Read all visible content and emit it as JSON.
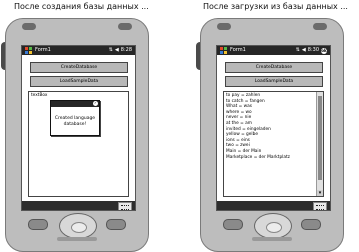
{
  "left": {
    "caption": "После создания базы данных ...",
    "window_title": "Form1",
    "time": "8:28",
    "buttons": [
      "CreateDatabase",
      "LoadSampleData"
    ],
    "textbox_text": "textBox",
    "popup_message": "Created language database!"
  },
  "right": {
    "caption": "После загрузки из  базы данных ...",
    "window_title": "Form1",
    "time": "8:30",
    "ok_label": "ok",
    "buttons": [
      "CreateDatabase",
      "LoadSampleData"
    ],
    "lines": [
      "to pay = zahlen",
      "to catch = fangen",
      "What = was",
      "where = wo",
      "never = nie",
      "at the = am",
      "invited = eingeladen",
      "yellow = gelbe",
      "ions = eins",
      "two = zwei",
      "Main = der Main",
      "Marketplace = der Marktplatz"
    ]
  },
  "icons": [
    "windows-flag-icon",
    "signal-icon",
    "speaker-icon",
    "ok-icon",
    "keyboard-icon",
    "scroll-down-icon"
  ],
  "colors": {
    "titlebar": "#262626",
    "device": "#bdbdbd",
    "button": "#b8b8b8"
  }
}
